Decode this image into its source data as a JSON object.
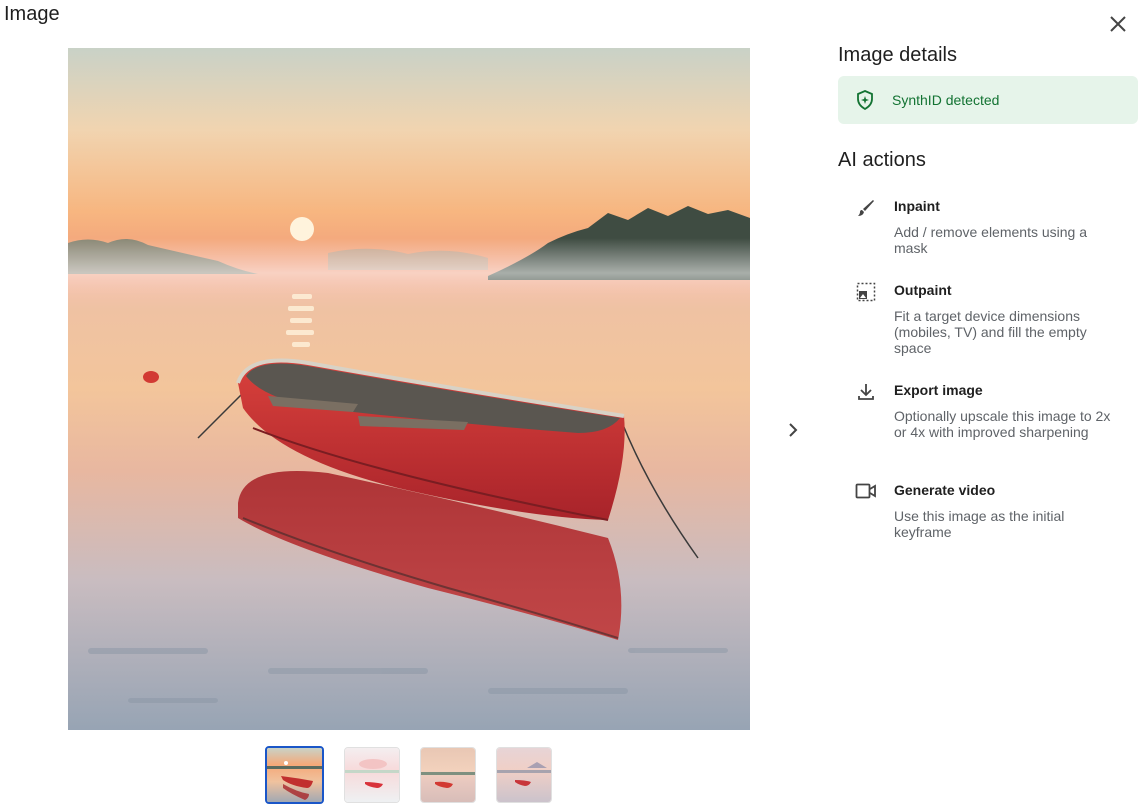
{
  "dialog": {
    "title": "Image"
  },
  "details": {
    "title": "Image details",
    "synthid": {
      "label": "SynthID detected",
      "color": "#137333",
      "background": "#e6f4ea",
      "icon": "shield-icon"
    }
  },
  "ai_actions": {
    "title": "AI actions",
    "items": [
      {
        "icon": "brush-icon",
        "name": "Inpaint",
        "description": "Add / remove elements using a mask"
      },
      {
        "icon": "outpaint-icon",
        "name": "Outpaint",
        "description": "Fit a target device dimensions (mobiles, TV) and fill the empty space"
      },
      {
        "icon": "download-icon",
        "name": "Export image",
        "description": "Optionally upscale this image to 2x or 4x with improved sharpening"
      },
      {
        "icon": "video-camera-icon",
        "name": "Generate video",
        "description": "Use this image as the initial keyframe"
      }
    ]
  },
  "gallery": {
    "thumbnail_count": 4,
    "selected_index": 0,
    "selected_color": "#1a56c8"
  }
}
